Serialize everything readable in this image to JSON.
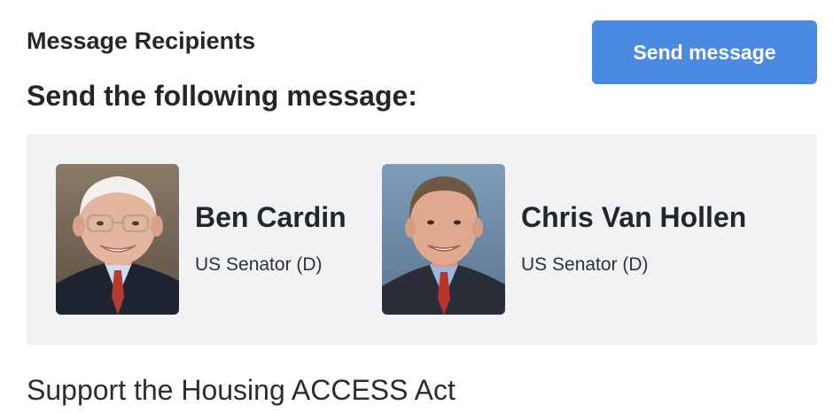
{
  "header": {
    "section_title": "Message Recipients",
    "instruction": "Send the following message:",
    "send_button_label": "Send message"
  },
  "colors": {
    "accent": "#4a8ae3",
    "panel_background": "#f1f2f4"
  },
  "recipients": [
    {
      "name": "Ben Cardin",
      "title": "US Senator (D)",
      "photo": "portrait-photo"
    },
    {
      "name": "Chris Van Hollen",
      "title": "US Senator (D)",
      "photo": "portrait-photo"
    }
  ],
  "message": {
    "subject": "Support the Housing ACCESS Act"
  }
}
